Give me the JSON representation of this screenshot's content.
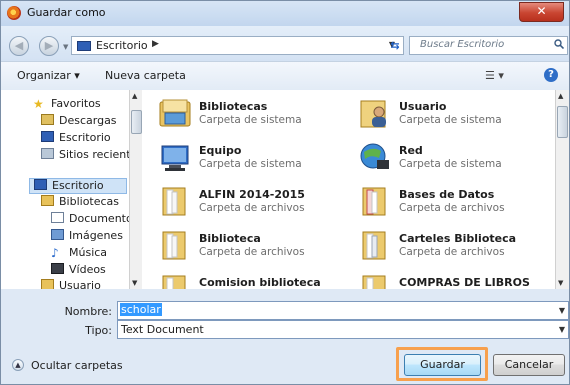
{
  "window": {
    "title": "Guardar como",
    "close_glyph": "✕"
  },
  "navigation": {
    "back_glyph": "◀",
    "forward_glyph": "▶",
    "address": {
      "segment": "Escritorio",
      "separator": "▶"
    },
    "search_placeholder": "Buscar Escritorio"
  },
  "toolbar": {
    "organize": "Organizar ▾",
    "new_folder": "Nueva carpeta",
    "view_glyph": "☰ ▾",
    "help": "?"
  },
  "sidebar": {
    "items": [
      {
        "label": "Favoritos",
        "icon": "star-icon"
      },
      {
        "label": "Descargas",
        "icon": "downloads-icon"
      },
      {
        "label": "Escritorio",
        "icon": "desktop-icon"
      },
      {
        "label": "Sitios recientes",
        "icon": "recent-places-icon"
      },
      {
        "label": "Escritorio",
        "icon": "desktop-icon"
      },
      {
        "label": "Bibliotecas",
        "icon": "libraries-icon"
      },
      {
        "label": "Documentos",
        "icon": "documents-icon"
      },
      {
        "label": "Imágenes",
        "icon": "pictures-icon"
      },
      {
        "label": "Música",
        "icon": "music-icon"
      },
      {
        "label": "Vídeos",
        "icon": "videos-icon"
      },
      {
        "label": "Usuario",
        "icon": "user-folder-icon"
      }
    ]
  },
  "content": {
    "items": [
      {
        "name": "Bibliotecas",
        "sub": "Carpeta de sistema",
        "icon": "libraries-folder-icon"
      },
      {
        "name": "Usuario",
        "sub": "Carpeta de sistema",
        "icon": "user-folder-icon"
      },
      {
        "name": "Equipo",
        "sub": "Carpeta de sistema",
        "icon": "computer-icon"
      },
      {
        "name": "Red",
        "sub": "Carpeta de sistema",
        "icon": "network-icon"
      },
      {
        "name": "ALFIN 2014-2015",
        "sub": "Carpeta de archivos",
        "icon": "folder-icon"
      },
      {
        "name": "Bases de Datos",
        "sub": "Carpeta de archivos",
        "icon": "folder-icon"
      },
      {
        "name": "Biblioteca",
        "sub": "Carpeta de archivos",
        "icon": "folder-icon"
      },
      {
        "name": "Carteles Biblioteca",
        "sub": "Carpeta de archivos",
        "icon": "folder-icon"
      },
      {
        "name": "Comision biblioteca",
        "sub": "",
        "icon": "folder-icon"
      },
      {
        "name": "COMPRAS DE LIBROS",
        "sub": "",
        "icon": "folder-icon"
      }
    ]
  },
  "form": {
    "filename_label": "Nombre:",
    "filename_value": "scholar",
    "type_label": "Tipo:",
    "type_value": "Text Document"
  },
  "footer": {
    "hide_folders": "Ocultar carpetas",
    "save": "Guardar",
    "cancel": "Cancelar"
  },
  "colors": {
    "accent": "#3399ff",
    "highlight": "#f7a04d"
  }
}
